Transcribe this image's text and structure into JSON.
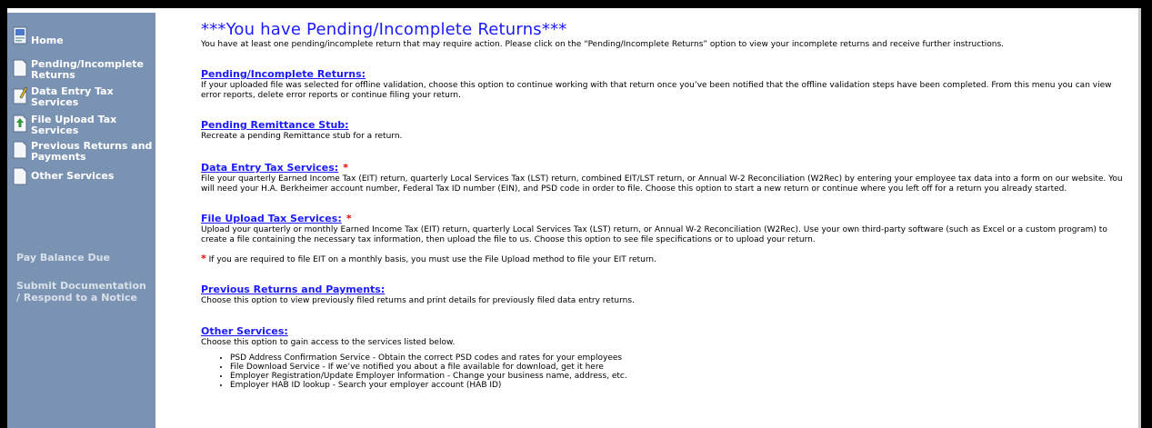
{
  "sidebar": {
    "items": [
      {
        "label": "Home",
        "icon": "home-page-icon"
      },
      {
        "label": "Pending/Incomplete Returns",
        "icon": "document-icon"
      },
      {
        "label": "Data Entry Tax Services",
        "icon": "pencil-document-icon"
      },
      {
        "label": "File Upload Tax Services",
        "icon": "upload-document-icon"
      },
      {
        "label": "Previous Returns and Payments",
        "icon": "document-icon"
      },
      {
        "label": "Other Services",
        "icon": "document-icon"
      }
    ],
    "pay_balance": "Pay Balance Due",
    "submit_doc": "Submit Documentation / Respond to a Notice"
  },
  "alert": {
    "title": "***You have Pending/Incomplete Returns***",
    "text": "You have at least one pending/incomplete return that may require action. Please click on the “Pending/Incomplete Returns” option to view your incomplete returns and receive further instructions."
  },
  "sections": {
    "pending": {
      "title": "Pending/Incomplete Returns:",
      "text": "If your uploaded file was selected for offline validation, choose this option to continue working with that return once you’ve been notified that the offline validation steps have been completed. From this menu you can view error reports, delete error reports or continue filing your return."
    },
    "remittance": {
      "title": "Pending Remittance Stub:",
      "text": "Recreate a pending Remittance stub for a return."
    },
    "data_entry": {
      "title": "Data Entry Tax Services:",
      "star": "*",
      "text": "File your quarterly Earned Income Tax (EIT) return, quarterly Local Services Tax (LST) return, combined EIT/LST return, or Annual W-2 Reconciliation (W2Rec) by entering your employee tax data into a form on our website. You will need your H.A. Berkheimer account number, Federal Tax ID number (EIN), and PSD code in order to file. Choose this option to start a new return or continue where you left off for a return you already started."
    },
    "file_upload": {
      "title": "File Upload Tax Services:",
      "star": "*",
      "text": "Upload your quarterly or monthly Earned Income Tax (EIT) return, quarterly Local Services Tax (LST) return, or Annual W-2 Reconciliation (W2Rec). Use your own third-party software (such as Excel or a custom program) to create a file containing the necessary tax information, then upload the file to us. Choose this option to see file specifications or to upload your return."
    },
    "note": {
      "star": "*",
      "text": "If you are required to file EIT on a monthly basis, you must use the File Upload method to file your EIT return."
    },
    "previous": {
      "title": "Previous Returns and Payments:",
      "text": "Choose this option to view previously filed returns and print details for previously filed data entry returns."
    },
    "other": {
      "title": "Other Services:",
      "text": "Choose this option to gain access to the services listed below.",
      "items": [
        "PSD Address Confirmation Service - Obtain the correct PSD codes and rates for your employees",
        "File Download Service - If we’ve notified you about a file available for download, get it here",
        "Employer Registration/Update Employer Information - Change your business name, address, etc.",
        "Employer HAB ID lookup - Search your employer account (HAB ID)"
      ]
    }
  },
  "colors": {
    "sidebar_bg": "#7b93b3",
    "link": "#1a1aff",
    "star": "#ee0000"
  }
}
